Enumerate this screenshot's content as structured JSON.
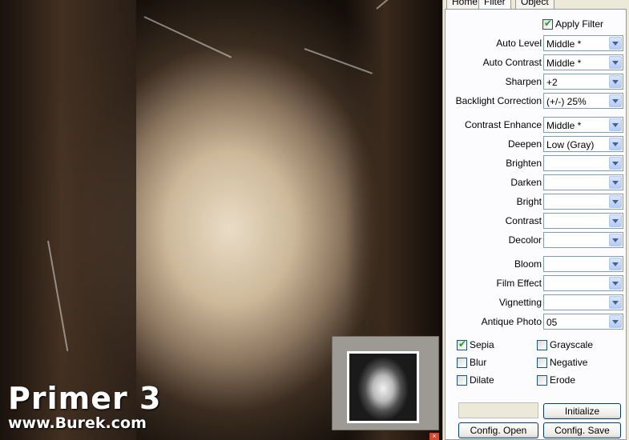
{
  "watermark": {
    "title": "Primer 3",
    "url": "www.Burek.com"
  },
  "thumbnail": {
    "close_glyph": "×"
  },
  "tabs": [
    {
      "label": "Home",
      "active": false
    },
    {
      "label": "Filter",
      "active": true
    },
    {
      "label": "Object",
      "active": false
    }
  ],
  "apply_filter": {
    "label": "Apply Filter",
    "checked": true
  },
  "settings": [
    {
      "label": "Auto Level",
      "value": "Middle *"
    },
    {
      "label": "Auto Contrast",
      "value": "Middle *"
    },
    {
      "label": "Sharpen",
      "value": "+2"
    },
    {
      "label": "Backlight Correction",
      "value": "(+/-) 25%"
    },
    {
      "label": "Contrast Enhance",
      "value": "Middle *"
    },
    {
      "label": "Deepen",
      "value": "Low (Gray)"
    },
    {
      "label": "Brighten",
      "value": ""
    },
    {
      "label": "Darken",
      "value": ""
    },
    {
      "label": "Bright",
      "value": ""
    },
    {
      "label": "Contrast",
      "value": ""
    },
    {
      "label": "Decolor",
      "value": ""
    },
    {
      "label": "Bloom",
      "value": ""
    },
    {
      "label": "Film Effect",
      "value": ""
    },
    {
      "label": "Vignetting",
      "value": ""
    },
    {
      "label": "Antique Photo",
      "value": "05"
    }
  ],
  "effects": [
    {
      "label": "Sepia",
      "checked": true
    },
    {
      "label": "Grayscale",
      "checked": false
    },
    {
      "label": "Blur",
      "checked": false
    },
    {
      "label": "Negative",
      "checked": false
    },
    {
      "label": "Dilate",
      "checked": false
    },
    {
      "label": "Erode",
      "checked": false
    }
  ],
  "buttons": {
    "initialize": "Initialize",
    "config_open": "Config. Open",
    "config_save": "Config. Save"
  },
  "colors": {
    "panel_bg": "#ece9d8",
    "tab_body": "#fcfcfe",
    "combo_border": "#7f9db9",
    "check_green": "#21a121",
    "sepia_light": "#e9dcc6",
    "sepia_dark": "#140e09"
  }
}
